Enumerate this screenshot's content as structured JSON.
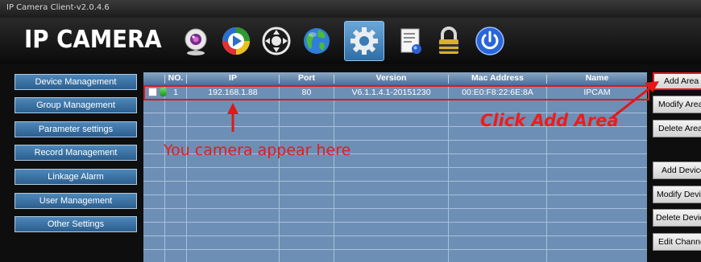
{
  "window": {
    "title": "IP Camera Client-v2.0.4.6"
  },
  "header": {
    "logo": "IP CAMERA",
    "icons": [
      "webcam-icon",
      "play-icon",
      "ptz-control-icon",
      "globe-icon",
      "settings-gear-icon",
      "document-icon",
      "lock-icon",
      "power-icon"
    ],
    "active_icon": "settings-gear-icon"
  },
  "sidebar": {
    "items": [
      "Device Management",
      "Group Management",
      "Parameter settings",
      "Record Management",
      "Linkage Alarm",
      "User Management",
      "Other Settings"
    ]
  },
  "table": {
    "columns": [
      "NO.",
      "IP",
      "Port",
      "Version",
      "Mac Address",
      "Name"
    ],
    "rows": [
      {
        "no": "1",
        "ip": "192.168.1.88",
        "port": "80",
        "version": "V6.1.1.4.1-20151230",
        "mac": "00:E0:F8:22:6E:8A",
        "name": "IPCAM"
      }
    ]
  },
  "right_panel": {
    "buttons": [
      "Add Area",
      "Modify Area",
      "Delete Area",
      "Add Device",
      "Modify Device",
      "Delete Device",
      "Edit Channel"
    ]
  },
  "annotations": {
    "click_add_area": "Click Add Area",
    "camera_here": "You camera appear here"
  },
  "colors": {
    "accent": "#2b5f8f",
    "annotation": "#e01818",
    "table_bg": "#6d8fb6"
  }
}
